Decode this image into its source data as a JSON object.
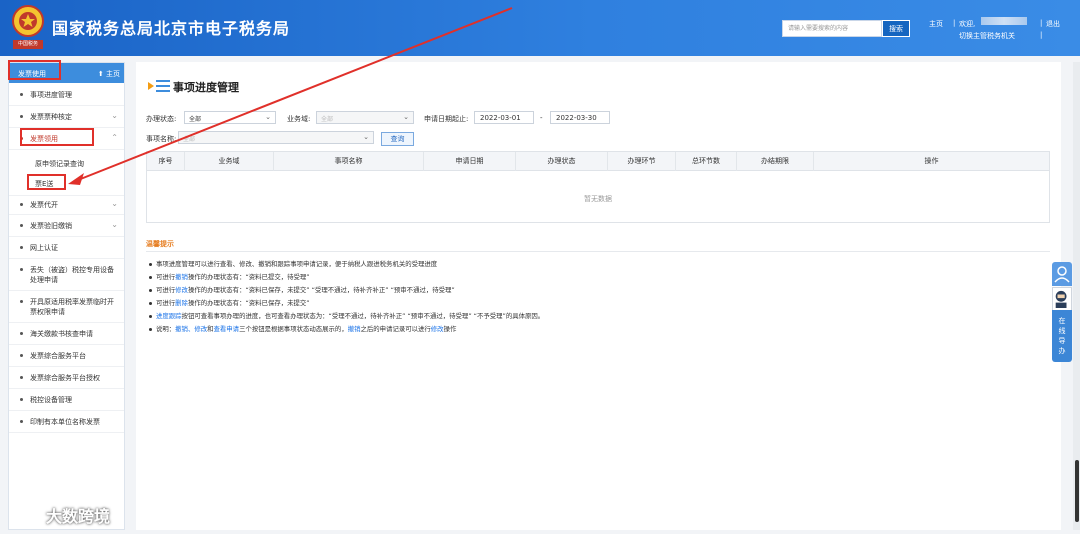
{
  "header": {
    "site_title": "国家税务总局北京市电子税务局",
    "emblem_text": "中国税务",
    "search_placeholder": "请输入需要搜索的内容",
    "search_button": "搜索",
    "home_link": "主页",
    "welcome": "欢迎,",
    "switch_agency": "切换主管税务机关",
    "logout": "退出",
    "sep": "|"
  },
  "sidebar": {
    "current": "发票使用",
    "home": "主页",
    "items": [
      {
        "label": "事项进度管理"
      },
      {
        "label": "发票票种核定"
      },
      {
        "label": "发票领用"
      },
      {
        "label": "原申领记录查询"
      },
      {
        "label": "票E送"
      },
      {
        "label": "发票代开"
      },
      {
        "label": "发票验旧缴销"
      },
      {
        "label": "网上认证"
      },
      {
        "label": "丢失（被盗）税控专用设备处理申请"
      },
      {
        "label": "开具原适用税率发票临时开票权限申请"
      },
      {
        "label": "海关缴款书核查申请"
      },
      {
        "label": "发票综合服务平台"
      },
      {
        "label": "发票综合服务平台授权"
      },
      {
        "label": "税控设备管理"
      },
      {
        "label": "印制有本单位名称发票"
      }
    ]
  },
  "main": {
    "title": "事项进度管理",
    "filters": {
      "status_label": "办理状态:",
      "status_value": "全部",
      "domain_label": "业务域:",
      "domain_value": "全部",
      "date_label": "申请日期起止:",
      "date_from": "2022-03-01",
      "date_dash": "-",
      "date_to": "2022-03-30",
      "name_label": "事项名称:",
      "name_value": "全部",
      "query_button": "查询"
    },
    "table": {
      "headers": [
        "序号",
        "业务域",
        "事项名称",
        "申请日期",
        "办理状态",
        "办理环节",
        "总环节数",
        "办结期限",
        "操作"
      ],
      "empty_text": "暂无数据"
    },
    "hints": {
      "title": "温馨提示",
      "lines": [
        {
          "parts": [
            "事项进度管理可以进行查看、修改、撤销和跟踪事项申请记录，便于纳税人跟进税务机关的受理进度"
          ]
        },
        {
          "parts": [
            "可进行",
            "撤销",
            "操作的办理状态有：“资料已提交，待受理”"
          ]
        },
        {
          "parts": [
            "可进行",
            "修改",
            "操作的办理状态有：“资料已保存，未提交”  “受理不通过，待补齐补正”  “预审不通过，待受理”"
          ]
        },
        {
          "parts": [
            "可进行",
            "删除",
            "操作的办理状态有：“资料已保存，未提交”"
          ]
        },
        {
          "parts": [
            "",
            "进度跟踪",
            "按钮可查看事项办理的进度，也可查看办理状态为：“受理不通过，待补齐补正”  “预审不通过，待受理”  “不予受理”的具体原因。"
          ]
        },
        {
          "parts": [
            "说明：",
            "撤销、修改",
            "和",
            "查看申请",
            "三个按钮是根据事项状态动态展示的，",
            "撤销",
            "之后的申请记录可以进行",
            "修改",
            "操作"
          ]
        }
      ]
    }
  },
  "help_widget": {
    "text": "在线导办"
  },
  "watermark": {
    "text": "大数跨境"
  },
  "colors": {
    "header_blue": "#2a74d4",
    "accent_red": "#e0302a",
    "link_blue": "#1a73e8",
    "hint_orange": "#e67e22"
  }
}
